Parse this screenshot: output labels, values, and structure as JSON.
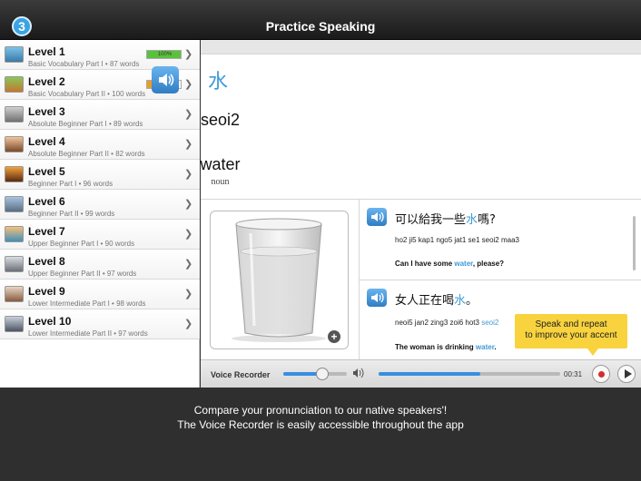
{
  "header": {
    "step": "3",
    "title": "Practice Speaking"
  },
  "sidebar": {
    "levels": [
      {
        "title": "Level 1",
        "subtitle": "Basic Vocabulary Part I • 87 words",
        "progress_label": "100%",
        "progress": 1.0,
        "progress_color": "#59c23b"
      },
      {
        "title": "Level 2",
        "subtitle": "Basic Vocabulary Part II • 100 words",
        "progress_label": "50%",
        "progress": 0.5,
        "progress_color": "#f19a24"
      },
      {
        "title": "Level 3",
        "subtitle": "Absolute Beginner Part I • 89 words"
      },
      {
        "title": "Level 4",
        "subtitle": "Absolute Beginner Part II • 82 words"
      },
      {
        "title": "Level 5",
        "subtitle": "Beginner Part I • 96 words"
      },
      {
        "title": "Level 6",
        "subtitle": "Beginner Part II • 99 words"
      },
      {
        "title": "Level 7",
        "subtitle": "Upper Beginner Part I • 90 words"
      },
      {
        "title": "Level 8",
        "subtitle": "Upper Beginner Part II • 97 words"
      },
      {
        "title": "Level 9",
        "subtitle": "Lower Intermediate Part I • 98 words"
      },
      {
        "title": "Level 10",
        "subtitle": "Lower Intermediate Part II • 97 words"
      }
    ]
  },
  "word": {
    "character": "水",
    "romanization": "seoi2",
    "english": "water",
    "part_of_speech": "noun"
  },
  "examples": [
    {
      "zh_pre": "可以給我一些",
      "zh_hl": "水",
      "zh_post": "嗎?",
      "rom_pre": "ho2 ji5 kap1 ngo5 jat1 se1 seoi2 maa3",
      "rom_hl": "",
      "rom_post": "",
      "en_pre": "Can I have some ",
      "en_hl": "water",
      "en_post": ", please?"
    },
    {
      "zh_pre": "女人正在喝",
      "zh_hl": "水",
      "zh_post": "。",
      "rom_pre": "neoi5 jan2 zing3 zoi6 hot3 ",
      "rom_hl": "seoi2",
      "rom_post": "",
      "en_pre": "The woman is drinking ",
      "en_hl": "water",
      "en_post": "."
    }
  ],
  "tooltip": {
    "line1": "Speak and repeat",
    "line2": "to improve your accent"
  },
  "recorder": {
    "label": "Voice Recorder",
    "time": "00:31",
    "volume": 0.62,
    "progress": 0.56
  },
  "caption": {
    "line1": "Compare your pronunciation to our native speakers'!",
    "line2": "The Voice Recorder is easily accessible throughout the app"
  },
  "colors": {
    "accent": "#3e9ad6",
    "record": "#d32f2f",
    "tooltip": "#f8d33e"
  },
  "icons": {
    "speaker": "speaker-icon",
    "chevron": "chevron-right-icon",
    "record": "record-icon",
    "play": "play-icon",
    "plus": "plus-icon"
  }
}
